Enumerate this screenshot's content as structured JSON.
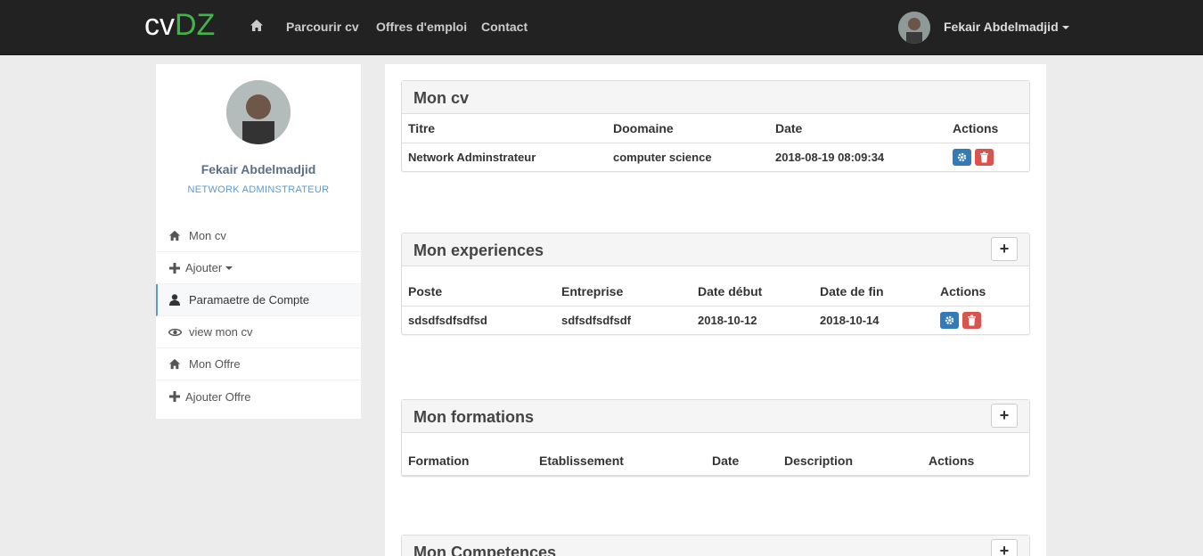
{
  "navbar": {
    "brand_cv": "cv",
    "brand_dz": "DZ",
    "links": [
      "Parcourir cv",
      "Offres d'emploi",
      "Contact"
    ],
    "user_name": "Fekair Abdelmadjid"
  },
  "sidebar": {
    "name": "Fekair Abdelmadjid",
    "title": "NETWORK ADMINSTRATEUR",
    "items": [
      {
        "label": "Mon cv",
        "icon": "home-icon"
      },
      {
        "label": "Ajouter",
        "icon": "plus-icon"
      },
      {
        "label": "Paramaetre de Compte",
        "icon": "user-icon"
      },
      {
        "label": "view mon cv",
        "icon": "eye-icon"
      },
      {
        "label": "Mon Offre",
        "icon": "home-icon"
      },
      {
        "label": "Ajouter Offre",
        "icon": "plus-icon"
      }
    ]
  },
  "cv_panel": {
    "title": "Mon cv",
    "headers": [
      "Titre",
      "Doomaine",
      "Date",
      "Actions"
    ],
    "row": {
      "titre": "Network Adminstrateur",
      "domaine": "computer science",
      "date": "2018-08-19 08:09:34"
    }
  },
  "exp_panel": {
    "title": "Mon experiences",
    "add": "+",
    "headers": [
      "Poste",
      "Entreprise",
      "Date début",
      "Date de fin",
      "Actions"
    ],
    "row": {
      "poste": "sdsdfsdfsdfsd",
      "entreprise": "sdfsdfsdfsdf",
      "debut": "2018-10-12",
      "fin": "2018-10-14"
    }
  },
  "form_panel": {
    "title": "Mon formations",
    "add": "+",
    "headers": [
      "Formation",
      "Etablissement",
      "Date",
      "Description",
      "Actions"
    ]
  },
  "comp_panel": {
    "title": "Mon Competences",
    "add": "+"
  },
  "colors": {
    "accent": "#3fb54a",
    "primary": "#337ab7",
    "danger": "#d9534f",
    "link": "#5a9bd5"
  }
}
